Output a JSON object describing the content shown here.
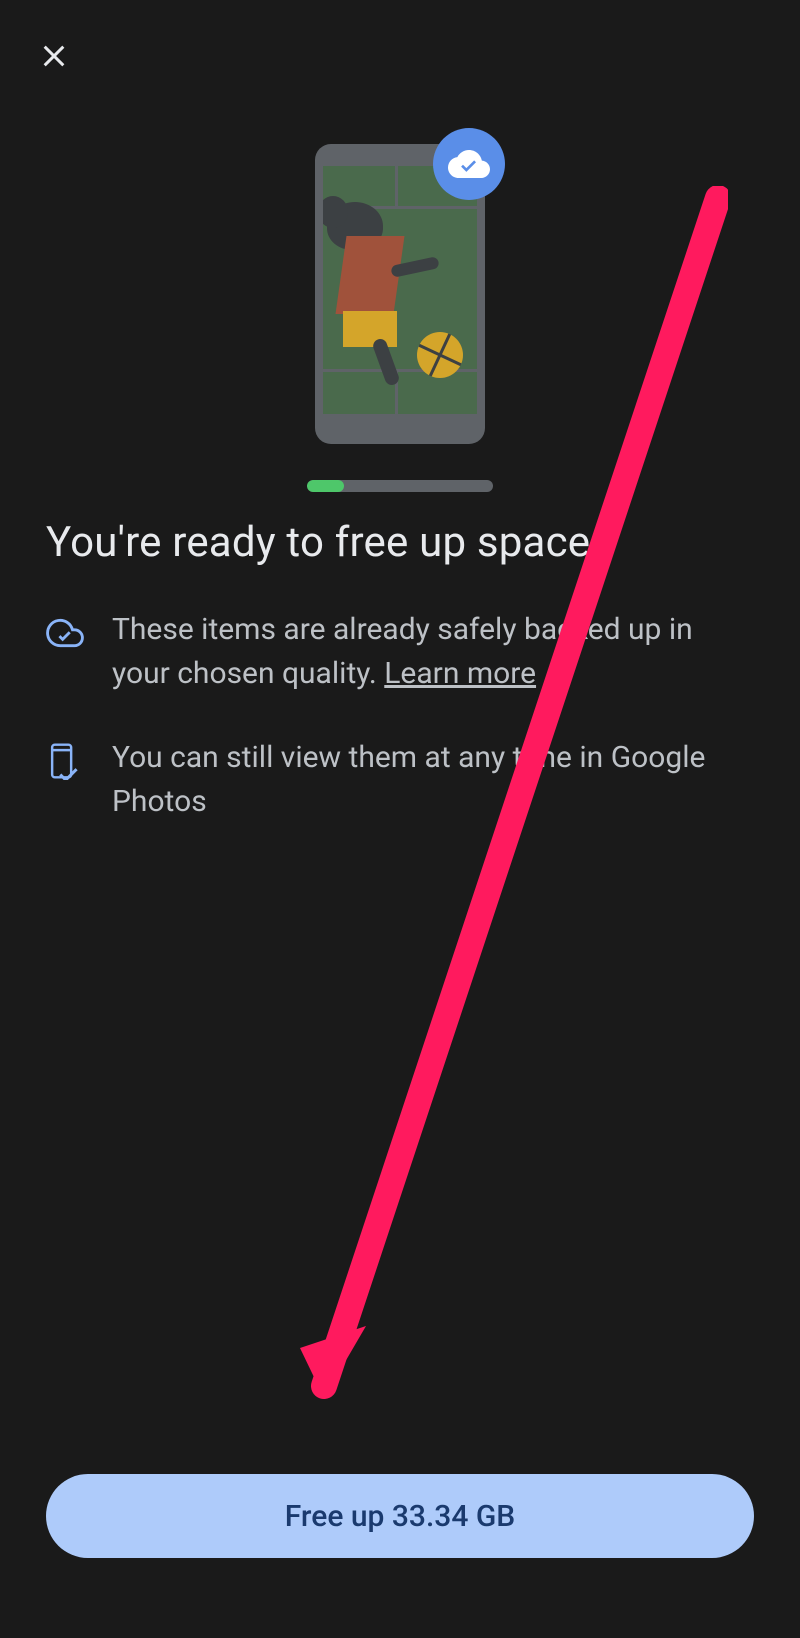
{
  "headline": "You're ready to free up space",
  "info": {
    "backup": {
      "text_before": "These items are already safely backed up in your chosen quality. ",
      "learn_more": "Learn more"
    },
    "view": "You can still view them at any time in Google Photos"
  },
  "cta": {
    "label": "Free up 33.34 GB"
  },
  "colors": {
    "accent": "#aecbfa",
    "annotation": "#ff1a5e"
  }
}
